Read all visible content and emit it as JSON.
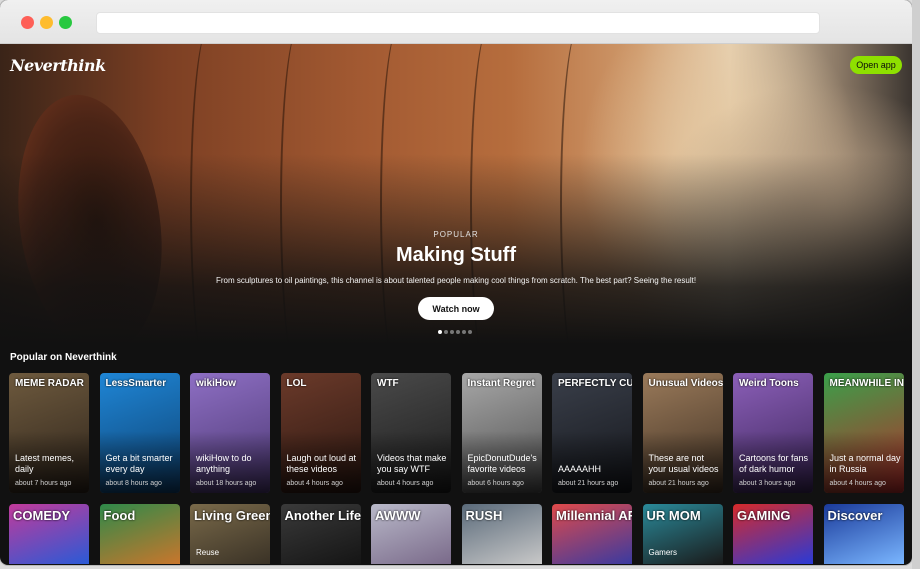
{
  "hero": {
    "logo": "Neverthink",
    "open_app_label": "Open app",
    "kicker": "POPULAR",
    "title": "Making Stuff",
    "description": "From sculptures to oil paintings, this channel is about talented people making cool things from scratch. The best part? Seeing the result!",
    "watch_label": "Watch now"
  },
  "popular": {
    "title": "Popular on Neverthink",
    "cards": [
      {
        "name": "MEME RADAR",
        "desc": "Latest memes, daily",
        "time": "about 7 hours ago",
        "color": "#6e5a3e",
        "color2": "#2d231a"
      },
      {
        "name": "LessSmarter",
        "desc": "Get a bit smarter every day",
        "time": "about 8 hours ago",
        "color": "#1f86d6",
        "color2": "#0d3f6e"
      },
      {
        "name": "wikiHow",
        "desc": "wikiHow to do anything",
        "time": "about 18 hours ago",
        "color": "#8e6fc4",
        "color2": "#4a3670"
      },
      {
        "name": "LOL",
        "desc": "Laugh out loud at these videos",
        "time": "about 4 hours ago",
        "color": "#6b3a2a",
        "color2": "#2a1610"
      },
      {
        "name": "WTF",
        "desc": "Videos that make you say WTF",
        "time": "about 4 hours ago",
        "color": "#4a4a4a",
        "color2": "#1a1a1a"
      },
      {
        "name": "Instant Regret",
        "desc": "EpicDonutDude's favorite videos",
        "time": "about 6 hours ago",
        "color": "#a7a7a7",
        "color2": "#4d4d4d"
      },
      {
        "name": "PERFECTLY CUT SCREAMS",
        "desc": "AAAAAHH",
        "time": "about 21 hours ago",
        "color": "#3a3f4a",
        "color2": "#14161b"
      },
      {
        "name": "Unusual Videos",
        "desc": "These are not your usual videos",
        "time": "about 21 hours ago",
        "color": "#9a7a5a",
        "color2": "#3e2f22"
      },
      {
        "name": "Weird Toons",
        "desc": "Cartoons for fans of dark humor",
        "time": "about 3 hours ago",
        "color": "#8b5fb8",
        "color2": "#3a2458"
      },
      {
        "name": "MEANWHILE IN RUSSIA",
        "desc": "Just a normal day in Russia",
        "time": "about 4 hours ago",
        "color": "#3aa04a",
        "color2": "#b82a2a"
      }
    ],
    "row2": [
      {
        "name": "COMEDY",
        "sub": "",
        "color": "#c23a9a",
        "color2": "#2a5ad6"
      },
      {
        "name": "Food",
        "sub": "",
        "color": "#2e8a4a",
        "color2": "#c9762c"
      },
      {
        "name": "Living Green",
        "sub": "Reuse",
        "color": "#7a6a4a",
        "color2": "#3a3226"
      },
      {
        "name": "Another Life",
        "sub": "",
        "color": "#3a3a3a",
        "color2": "#151515"
      },
      {
        "name": "AWWW",
        "sub": "",
        "color": "#b9b9c9",
        "color2": "#7a6a8a"
      },
      {
        "name": "RUSH",
        "sub": "",
        "color": "#5a6a7a",
        "color2": "#c8c8c8"
      },
      {
        "name": "Millennial AF",
        "sub": "",
        "color": "#e04a4a",
        "color2": "#3a3aa0"
      },
      {
        "name": "UR MOM",
        "sub": "Gamers",
        "color": "#2a8a9a",
        "color2": "#1a1a1a"
      },
      {
        "name": "GAMING",
        "sub": "",
        "color": "#d62a2a",
        "color2": "#2a3ad6"
      },
      {
        "name": "Discover",
        "sub": "",
        "color": "#1a3a9a",
        "color2": "#7ab6ff"
      }
    ]
  }
}
